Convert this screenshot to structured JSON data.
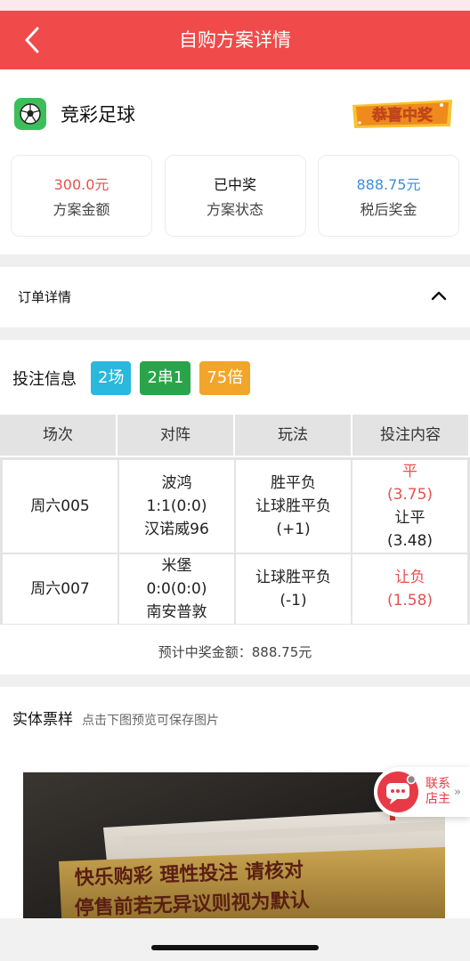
{
  "header": {
    "title": "自购方案详情"
  },
  "summary": {
    "brand": "竞彩足球",
    "stamp": "恭喜中奖",
    "stats": [
      {
        "value": "300.0元",
        "label": "方案金额",
        "color": "#e8504f"
      },
      {
        "value": "已中奖",
        "label": "方案状态",
        "color": "#111111"
      },
      {
        "value": "888.75元",
        "label": "税后奖金",
        "color": "#3a8fe0"
      }
    ]
  },
  "order": {
    "label": "订单详情"
  },
  "bet": {
    "label": "投注信息",
    "tags": [
      "2场",
      "2串1",
      "75倍"
    ],
    "columns": [
      "场次",
      "对阵",
      "玩法",
      "投注内容"
    ],
    "rows": [
      {
        "match_no": "周六005",
        "home": "波鸿",
        "score": "1:1(0:0)",
        "away": "汉诺威96",
        "play1": "胜平负",
        "play2": "让球胜平负",
        "handicap": "(+1)",
        "pick1": "平",
        "odds1": "(3.75)",
        "pick2": "让平",
        "odds2": "(3.48)"
      },
      {
        "match_no": "周六007",
        "home": "米堡",
        "score": "0:0(0:0)",
        "away": "南安普敦",
        "play1": "让球胜平负",
        "handicap": "(-1)",
        "pick1": "让负",
        "odds1": "(1.58)"
      }
    ],
    "prize_text": "预计中奖金额：888.75元"
  },
  "ticket": {
    "label": "实体票样",
    "hint": "点击下图预览可保存图片",
    "photo_line1": "快乐购彩  理性投注  请核对",
    "photo_line2": "停售前若无异议则视为默认"
  },
  "contact": {
    "label": "联系店主",
    "arrow": "»"
  }
}
